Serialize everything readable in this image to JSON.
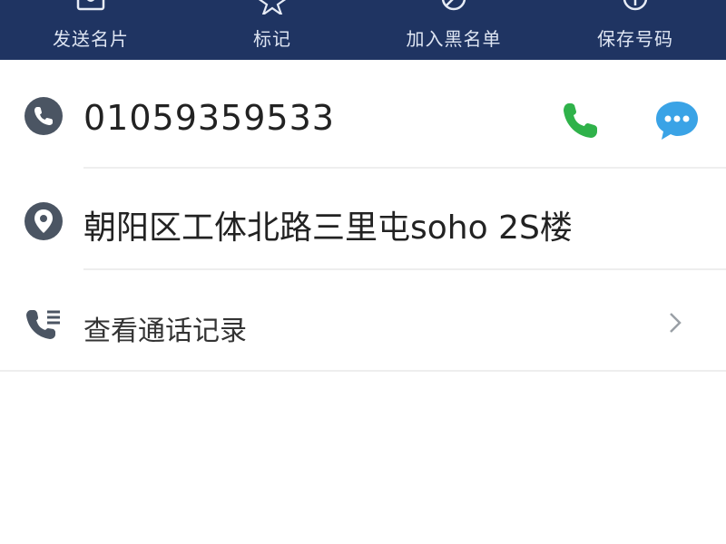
{
  "toolbar": {
    "items": [
      {
        "label": "发送名片",
        "icon": "card-icon"
      },
      {
        "label": "标记",
        "icon": "star-icon"
      },
      {
        "label": "加入黑名单",
        "icon": "block-icon"
      },
      {
        "label": "保存号码",
        "icon": "plus-icon"
      }
    ]
  },
  "contact": {
    "phone": "01059359533",
    "address": "朝阳区工体北路三里屯soho 2S楼",
    "call_log_label": "查看通话记录"
  },
  "colors": {
    "toolbar_bg": "#1f3462",
    "call_green": "#2fb24a",
    "message_blue": "#3aa3e6",
    "icon_gray": "#4b5563"
  }
}
